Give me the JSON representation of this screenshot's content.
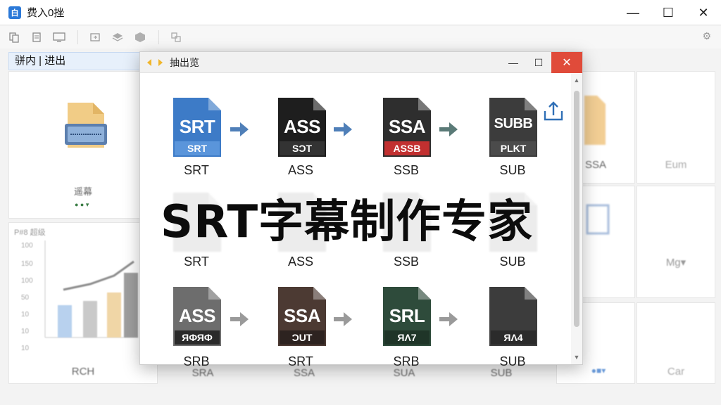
{
  "window": {
    "title": "费入0挫",
    "app_icon_glyph": "白",
    "controls": {
      "minimize": "—",
      "maximize": "☐",
      "close": "✕"
    }
  },
  "toolbar": {
    "icons": [
      "copy-icon",
      "paste-icon",
      "preview-icon",
      "import-icon",
      "layers-icon",
      "box-icon",
      "cut-icon"
    ],
    "right_glyph": "⚙"
  },
  "left_panel": {
    "tab_label": "骈内 | 进出",
    "folder_label": "遥幕",
    "chart_title": "P#8 超级",
    "ticks": [
      "100",
      "150",
      "100",
      "50",
      "10",
      "10",
      "10"
    ],
    "bottom_label": "RCH"
  },
  "background_labels": {
    "r1": "SSA",
    "r2": "Eum",
    "r3": "Mg▾",
    "r4": "Car",
    "bottom": [
      "SRA",
      "SSA",
      "SUA",
      "SUB"
    ]
  },
  "dialog": {
    "title": "抽出览",
    "controls": {
      "minimize": "—",
      "maximize": "☐",
      "close": "✕"
    },
    "headline": "SRT字幕制作专家",
    "row1": [
      {
        "big": "SRT",
        "strip": "SRT",
        "label": "SRT",
        "color": "#3d7bc7",
        "strip_color": "#5a95db"
      },
      {
        "big": "ASS",
        "strip": "SƆT",
        "label": "ASS",
        "color": "#1e1e1e",
        "strip_color": "#333333"
      },
      {
        "big": "SSA",
        "strip": "ASSB",
        "label": "SSB",
        "color": "#2e2e2e",
        "strip_color": "#c23030"
      },
      {
        "big": "SUBB",
        "strip": "PLKT",
        "label": "SUB",
        "color": "#3c3c3c",
        "strip_color": "#4b4b4b"
      }
    ],
    "row2_labels": [
      "SRT",
      "ASS",
      "SSB",
      "SUB"
    ],
    "row3": [
      {
        "big": "ASS",
        "strip": "ЯФЯФ",
        "label": "SRB",
        "color": "#6d6d6d",
        "strip_color": "#2a2a2a"
      },
      {
        "big": "SSA",
        "strip": "ƆUT",
        "label": "SRT",
        "color": "#4c3a33",
        "strip_color": "#2d2320"
      },
      {
        "big": "SRL",
        "strip": "ЯɅ7",
        "label": "SRB",
        "color": "#2e4b3b",
        "strip_color": "#1f3528"
      },
      {
        "big": "",
        "strip": "ЯɅ4",
        "label": "SUB",
        "color": "#3c3c3c",
        "strip_color": "#2b2b2b"
      }
    ]
  }
}
